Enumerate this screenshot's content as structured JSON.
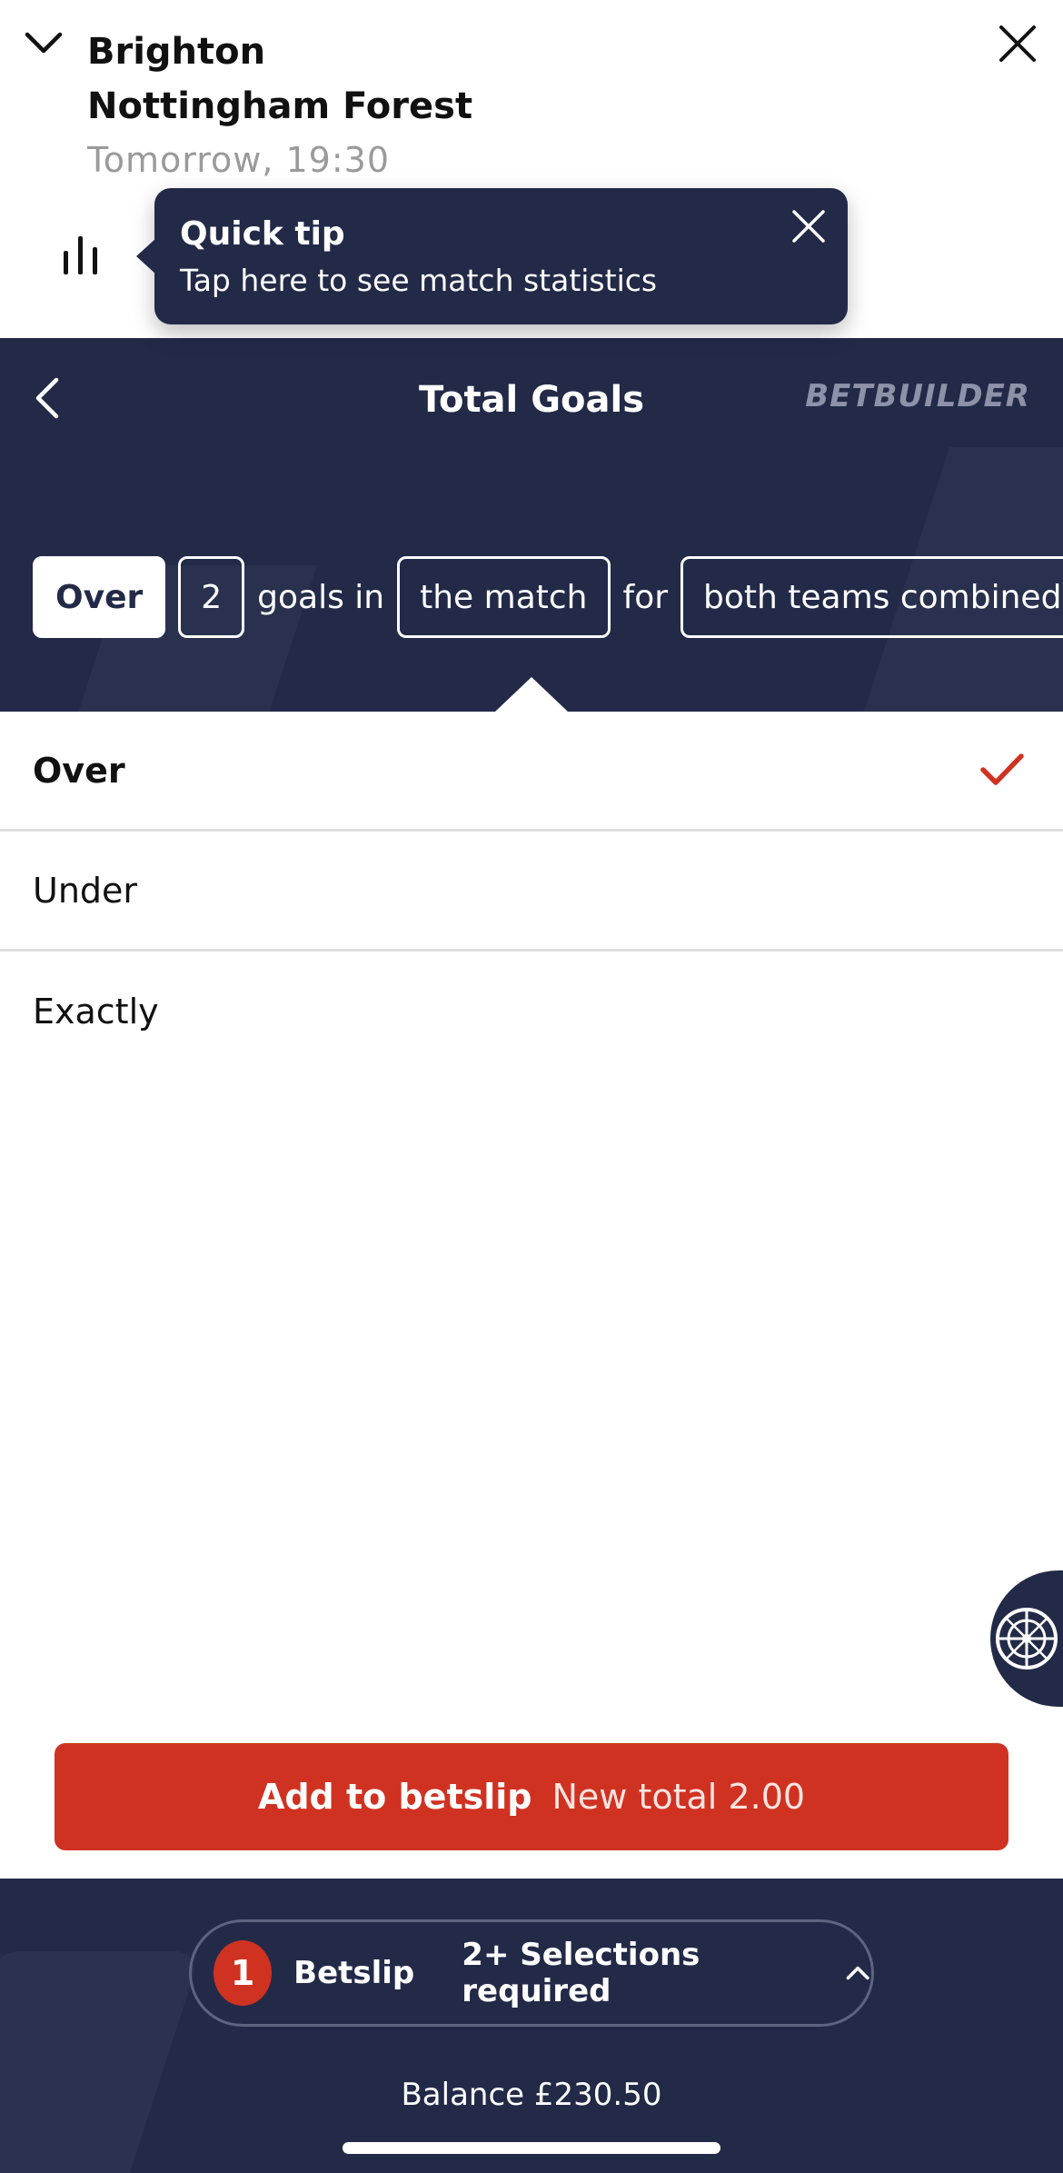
{
  "match": {
    "home_team": "Brighton",
    "away_team": "Nottingham Forest",
    "kickoff": "Tomorrow, 19:30"
  },
  "tooltip": {
    "title": "Quick tip",
    "text": "Tap here to see match statistics"
  },
  "market": {
    "title": "Total Goals",
    "brand": "BETBUILDER",
    "sentence": {
      "selection": "Over",
      "line": "2",
      "word_goals_in": "goals in",
      "period": "the match",
      "word_for": "for",
      "team": "both teams combined"
    }
  },
  "options": [
    {
      "label": "Over",
      "selected": true
    },
    {
      "label": "Under",
      "selected": false
    },
    {
      "label": "Exactly",
      "selected": false
    }
  ],
  "add_to_betslip": {
    "label": "Add to betslip",
    "total": "New total 2.00"
  },
  "betslip": {
    "count": "1",
    "label": "Betslip",
    "requirement": "2+ Selections required",
    "balance": "Balance £230.50"
  },
  "colors": {
    "navy": "#232a48",
    "accent_red": "#d03222",
    "muted_text": "#9a9a9a"
  },
  "icons": {
    "collapse": "chevron-down-icon",
    "close": "close-icon",
    "stats": "bar-chart-icon",
    "back": "chevron-left-icon",
    "check": "check-icon",
    "casino": "roulette-wheel-icon",
    "expand_betslip": "chevron-up-icon"
  }
}
